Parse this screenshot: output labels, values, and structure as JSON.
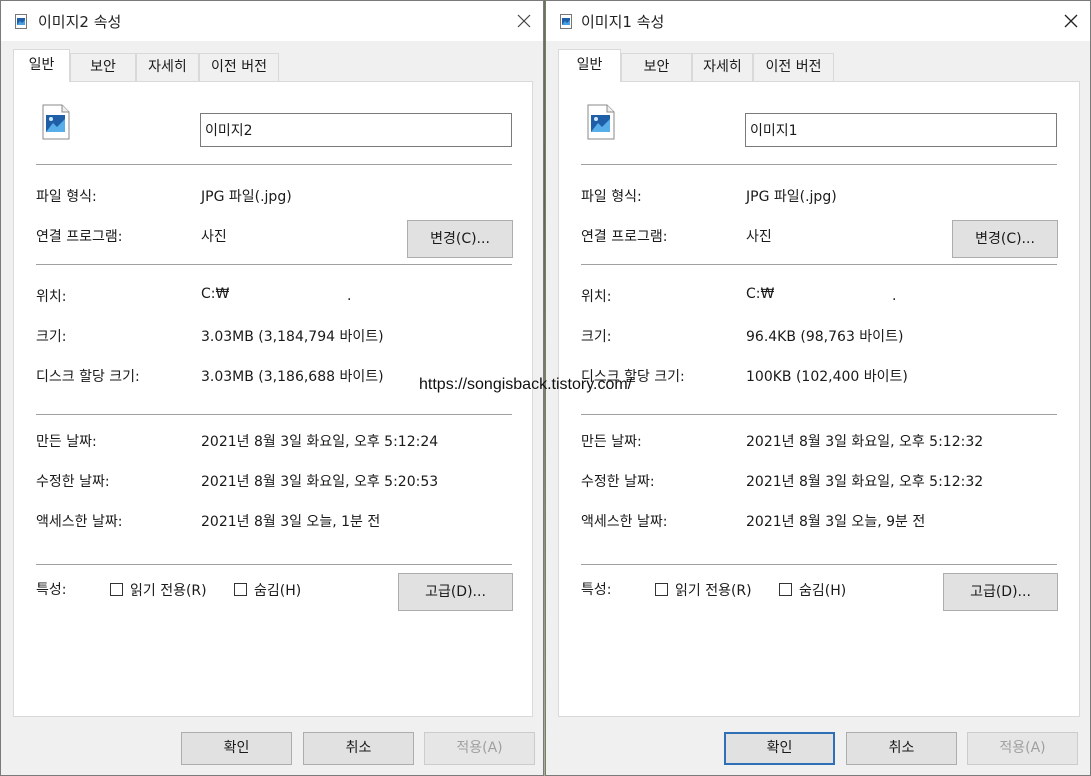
{
  "watermark": "https://songisback.tistory.com/",
  "colors": {
    "accent_default_border": "#2f6fb5",
    "panel_bg": "#ffffff",
    "dialog_bg": "#f0f0f0"
  },
  "dialogs": [
    {
      "title": "이미지2 속성",
      "tabs": [
        "일반",
        "보안",
        "자세히",
        "이전 버전"
      ],
      "file_name": "이미지2",
      "file_type_label": "파일 형식:",
      "file_type": "JPG 파일(.jpg)",
      "open_with_label": "연결 프로그램:",
      "open_with": "사진",
      "change_button": "변경(C)...",
      "location_label": "위치:",
      "location": "C:₩",
      "size_label": "크기:",
      "size": "3.03MB (3,184,794 바이트)",
      "disk_size_label": "디스크 할당 크기:",
      "disk_size": "3.03MB (3,186,688 바이트)",
      "created_label": "만든 날짜:",
      "created": "2021년 8월 3일 화요일, 오후 5:12:24",
      "modified_label": "수정한 날짜:",
      "modified": "2021년 8월 3일 화요일, 오후 5:20:53",
      "accessed_label": "액세스한 날짜:",
      "accessed": "2021년 8월 3일 오늘, 1분 전",
      "attributes_label": "특성:",
      "readonly_label": "읽기 전용(R)",
      "hidden_label": "숨김(H)",
      "advanced_button": "고급(D)...",
      "ok_button": "확인",
      "cancel_button": "취소",
      "apply_button": "적용(A)"
    },
    {
      "title": "이미지1 속성",
      "tabs": [
        "일반",
        "보안",
        "자세히",
        "이전 버전"
      ],
      "file_name": "이미지1",
      "file_type_label": "파일 형식:",
      "file_type": "JPG 파일(.jpg)",
      "open_with_label": "연결 프로그램:",
      "open_with": "사진",
      "change_button": "변경(C)...",
      "location_label": "위치:",
      "location": "C:₩",
      "size_label": "크기:",
      "size": "96.4KB (98,763 바이트)",
      "disk_size_label": "디스크 할당 크기:",
      "disk_size": "100KB (102,400 바이트)",
      "created_label": "만든 날짜:",
      "created": "2021년 8월 3일 화요일, 오후 5:12:32",
      "modified_label": "수정한 날짜:",
      "modified": "2021년 8월 3일 화요일, 오후 5:12:32",
      "accessed_label": "액세스한 날짜:",
      "accessed": "2021년 8월 3일 오늘, 9분 전",
      "attributes_label": "특성:",
      "readonly_label": "읽기 전용(R)",
      "hidden_label": "숨김(H)",
      "advanced_button": "고급(D)...",
      "ok_button": "확인",
      "cancel_button": "취소",
      "apply_button": "적용(A)"
    }
  ]
}
